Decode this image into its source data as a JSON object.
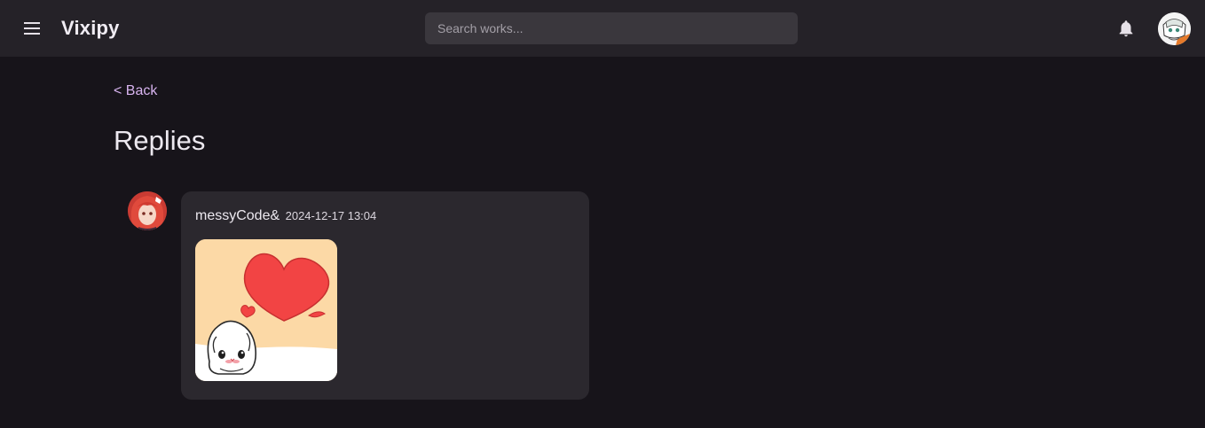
{
  "header": {
    "app_name": "Vixipy",
    "menu_icon": "menu-icon",
    "search_placeholder": "Search works...",
    "search_value": "",
    "notification_icon": "bell-icon",
    "user_avatar": "user-avatar"
  },
  "nav": {
    "back_label": "< Back"
  },
  "page": {
    "title": "Replies"
  },
  "replies": [
    {
      "username": "messyCode&",
      "timestamp": "2024-12-17 13:04",
      "content_type": "sticker",
      "sticker_icon": "heart-sticker"
    }
  ],
  "colors": {
    "background": "#17141a",
    "topbar": "#252228",
    "card": "#2b282e",
    "link": "#d8b4f0",
    "heart": "#f24444",
    "sticker_bg": "#fcd9a6"
  }
}
